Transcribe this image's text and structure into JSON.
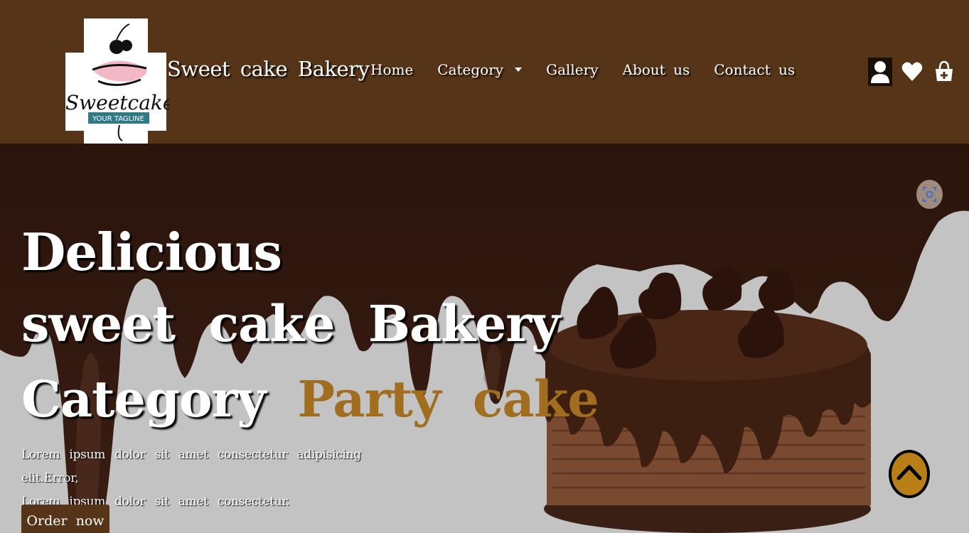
{
  "brand": {
    "logo_text": "Sweetcake",
    "logo_tagline": "YOUR TAGLINE",
    "name": "Sweet cake Bakery"
  },
  "nav": {
    "items": [
      {
        "label": "Home"
      },
      {
        "label": "Category"
      },
      {
        "label": "Gallery"
      },
      {
        "label": "About us"
      },
      {
        "label": "Contact us"
      }
    ]
  },
  "header_icons": [
    "user-icon",
    "heart-icon",
    "shopping-bag-icon"
  ],
  "hero": {
    "line1": "Delicious",
    "line2": "sweet cake Bakery",
    "line3_prefix": "Category",
    "line3_accent": "Party cake",
    "paragraph_line1": "Lorem ipsum dolor sit amet consectetur adipisicing elit.Error,",
    "paragraph_line2": "Lorem ipsum dolor sit amet consectetur.",
    "cta_label": "Order now"
  },
  "colors": {
    "navbar_bg": "#563418",
    "accent": "#a16d1e",
    "chocolate": "#2a140c",
    "hero_bg": "#c3c3c3",
    "scroll_button": "#b77f15"
  }
}
